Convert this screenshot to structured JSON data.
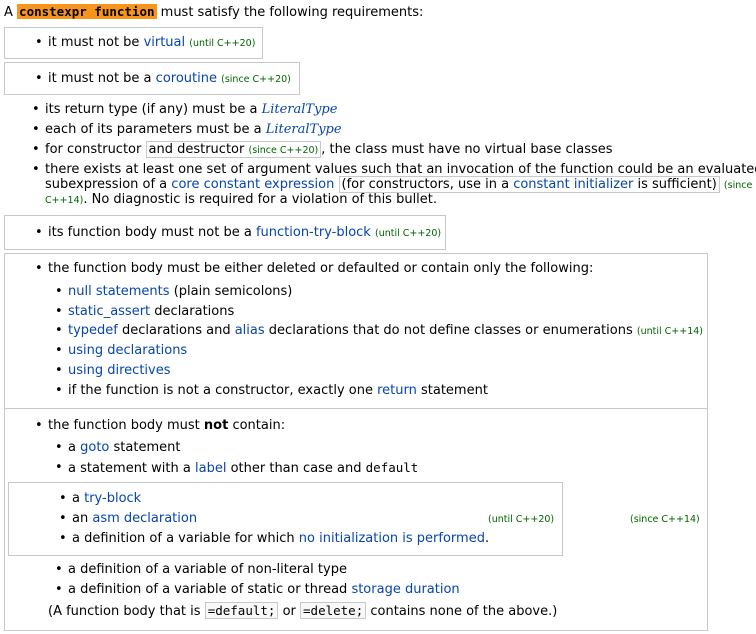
{
  "intro": {
    "prefix": "A",
    "keyword": "constexpr function",
    "suffix": "must satisfy the following requirements:"
  },
  "req_virtual": {
    "text": "it must not be",
    "link": "virtual",
    "ver": "(until C++20)"
  },
  "req_coroutine": {
    "text": "it must not be a",
    "link": "coroutine",
    "ver": "(since C++20)"
  },
  "req_return": {
    "text": "its return type (if any) must be a",
    "link": "LiteralType"
  },
  "req_params": {
    "text": "each of its parameters must be a",
    "link": "LiteralType"
  },
  "req_ctor": {
    "pre": "for constructor",
    "boxed": "and destructor",
    "ver": "(since C++20)",
    "post": ", the class must have no virtual base classes"
  },
  "req_args": {
    "line1": "there exists at least one set of argument values such that an invocation of the function could be an evaluated",
    "l2_pre": "subexpression of a",
    "l2_link": "core constant expression",
    "l2_mid": "(for constructors, use in a",
    "l2_link2": "constant initializer",
    "l2_post": "is sufficient)",
    "l2_ver": "(since",
    "l3_ver": "C++14)",
    "l3_text": ". No diagnostic is required for a violation of this bullet."
  },
  "req_trybody": {
    "text": "its function body must not be a",
    "link": "function-try-block",
    "ver": "(until C++20)"
  },
  "body_allowed": {
    "heading": "the function body must be either deleted or defaulted or contain only the following:",
    "null_link": "null statements",
    "null_text": "(plain semicolons)",
    "static_link": "static_assert",
    "static_text": "declarations",
    "typedef_link": "typedef",
    "typedef_mid": "declarations and",
    "alias_link": "alias",
    "typedef_post": "declarations that do not define classes or enumerations",
    "typedef_ver": "(until C++14)",
    "using_decl": "using declarations",
    "using_dir": "using directives",
    "return_pre": "if the function is not a constructor, exactly one",
    "return_link": "return",
    "return_post": "statement"
  },
  "body_forbidden": {
    "heading_pre": "the function body must",
    "heading_bold": "not",
    "heading_post": "contain:",
    "goto_pre": "a",
    "goto_link": "goto",
    "goto_post": "statement",
    "label_pre": "a statement with a",
    "label_link": "label",
    "label_mid": "other than case and",
    "label_code": "default",
    "try_pre": "a",
    "try_link": "try-block",
    "asm_pre": "an",
    "asm_link": "asm declaration",
    "asm_ver": "(until C++20)",
    "noinit_pre": "a definition of a variable for which",
    "noinit_link": "no initialization is performed",
    "noinit_post": ".",
    "outer_ver": "(since C++14)",
    "nonliteral": "a definition of a variable of non-literal type",
    "storage_pre": "a definition of a variable of static or thread",
    "storage_link": "storage duration",
    "note_pre": "(A function body that is",
    "note_code1": "=default;",
    "note_mid": "or",
    "note_code2": "=delete;",
    "note_post": "contains none of the above.)"
  }
}
